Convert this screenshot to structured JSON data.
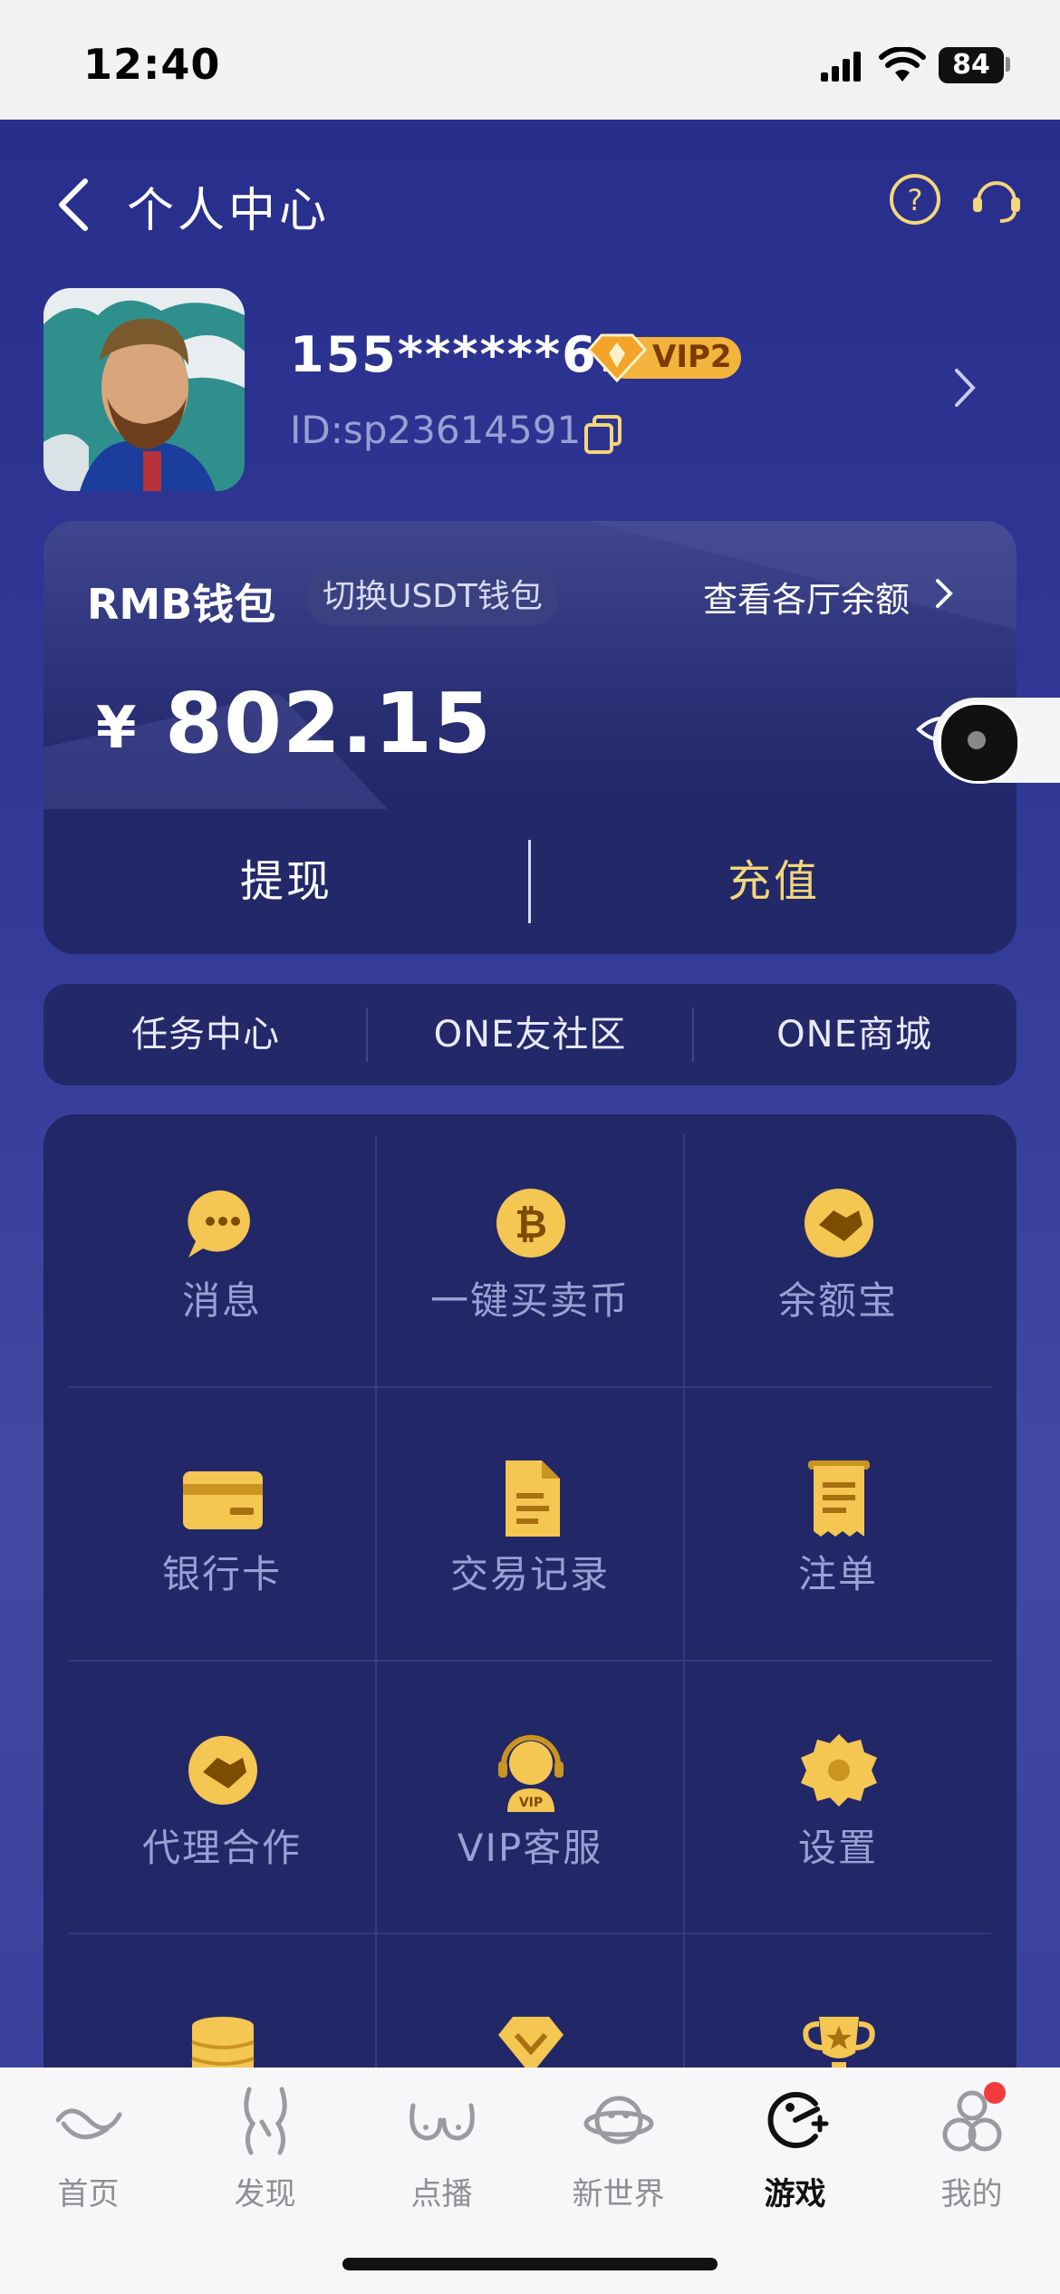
{
  "status_bar": {
    "time": "12:40",
    "battery": "84"
  },
  "header": {
    "title": "个人中心"
  },
  "profile": {
    "username": "155******61",
    "vip_level": "VIP2",
    "user_id": "ID:sp23614591"
  },
  "wallet": {
    "title": "RMB钱包",
    "switch_label": "切换USDT钱包",
    "view_balances": "查看各厅余额",
    "currency_symbol": "¥",
    "balance": "802.15",
    "withdraw": "提现",
    "deposit": "充值"
  },
  "quick_links": [
    "任务中心",
    "ONE友社区",
    "ONE商城"
  ],
  "grid": [
    {
      "label": "消息",
      "icon": "message-icon"
    },
    {
      "label": "一键买卖币",
      "icon": "bitcoin-icon"
    },
    {
      "label": "余额宝",
      "icon": "handshake-icon"
    },
    {
      "label": "银行卡",
      "icon": "bank-card-icon"
    },
    {
      "label": "交易记录",
      "icon": "document-icon"
    },
    {
      "label": "注单",
      "icon": "receipt-icon"
    },
    {
      "label": "代理合作",
      "icon": "handshake-icon"
    },
    {
      "label": "VIP客服",
      "icon": "vip-support-icon"
    },
    {
      "label": "设置",
      "icon": "gear-icon"
    }
  ],
  "tabbar": [
    {
      "label": "首页",
      "icon": "home-icon"
    },
    {
      "label": "发现",
      "icon": "discover-icon"
    },
    {
      "label": "点播",
      "icon": "on-demand-icon"
    },
    {
      "label": "新世界",
      "icon": "planet-icon"
    },
    {
      "label": "游戏",
      "icon": "game-icon",
      "active": true
    },
    {
      "label": "我的",
      "icon": "profile-icon",
      "badge": true
    }
  ],
  "colors": {
    "background": "#2c3290",
    "card": "#222767",
    "gold": "#f3d77a",
    "muted_text": "#9aa0d4"
  }
}
